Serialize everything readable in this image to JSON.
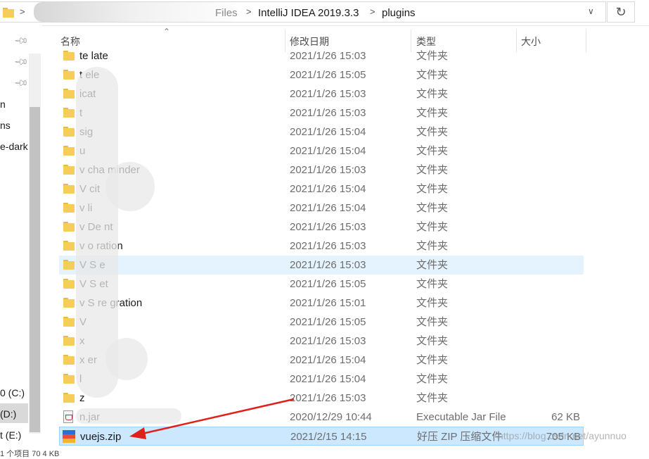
{
  "address_bar": {
    "segments": [
      "Files",
      "IntelliJ IDEA 2019.3.3",
      "plugins"
    ],
    "refresh_icon": "refresh-icon",
    "dropdown_icon": "chevron-down-icon"
  },
  "nav_pane": {
    "partial_labels": [
      "n",
      "ns",
      "e-dark"
    ],
    "drives": [
      "0 (C:)",
      "(D:)",
      "t (E:)"
    ],
    "status_fragment": "1 个项目 70 4 KB"
  },
  "columns": {
    "name": "名称",
    "date": "修改日期",
    "type": "类型",
    "size": "大小"
  },
  "rows": [
    {
      "name": "te    late",
      "date": "2021/1/26 15:03",
      "type": "文件夹",
      "size": "",
      "icon": "folder-icon"
    },
    {
      "name": "t    ele",
      "date": "2021/1/26 15:05",
      "type": "文件夹",
      "size": "",
      "icon": "folder-icon"
    },
    {
      "name": "    icat",
      "date": "2021/1/26 15:03",
      "type": "文件夹",
      "size": "",
      "icon": "folder-icon"
    },
    {
      "name": "     t",
      "date": "2021/1/26 15:03",
      "type": "文件夹",
      "size": "",
      "icon": "folder-icon"
    },
    {
      "name": "    sig",
      "date": "2021/1/26 15:04",
      "type": "文件夹",
      "size": "",
      "icon": "folder-icon"
    },
    {
      "name": "u",
      "date": "2021/1/26 15:04",
      "type": "文件夹",
      "size": "",
      "icon": "folder-icon"
    },
    {
      "name": "v    cha         minder",
      "date": "2021/1/26 15:03",
      "type": "文件夹",
      "size": "",
      "icon": "folder-icon"
    },
    {
      "name": "V    cit",
      "date": "2021/1/26 15:04",
      "type": "文件夹",
      "size": "",
      "icon": "folder-icon"
    },
    {
      "name": "v    li",
      "date": "2021/1/26 15:04",
      "type": "文件夹",
      "size": "",
      "icon": "folder-icon"
    },
    {
      "name": "v    De          nt",
      "date": "2021/1/26 15:03",
      "type": "文件夹",
      "size": "",
      "icon": "folder-icon"
    },
    {
      "name": "v    o             ration",
      "date": "2021/1/26 15:03",
      "type": "文件夹",
      "size": "",
      "icon": "folder-icon"
    },
    {
      "name": "V    S      e",
      "date": "2021/1/26 15:03",
      "type": "文件夹",
      "size": "",
      "icon": "folder-icon"
    },
    {
      "name": "V    S      et",
      "date": "2021/1/26 15:05",
      "type": "文件夹",
      "size": "",
      "icon": "folder-icon"
    },
    {
      "name": "v    S      re     gration",
      "date": "2021/1/26 15:01",
      "type": "文件夹",
      "size": "",
      "icon": "folder-icon"
    },
    {
      "name": "V",
      "date": "2021/1/26 15:05",
      "type": "文件夹",
      "size": "",
      "icon": "folder-icon"
    },
    {
      "name": "x",
      "date": "2021/1/26 15:03",
      "type": "文件夹",
      "size": "",
      "icon": "folder-icon"
    },
    {
      "name": "x              er",
      "date": "2021/1/26 15:04",
      "type": "文件夹",
      "size": "",
      "icon": "folder-icon"
    },
    {
      "name": "    l",
      "date": "2021/1/26 15:04",
      "type": "文件夹",
      "size": "",
      "icon": "folder-icon"
    },
    {
      "name": "z",
      "date": "2021/1/26 15:03",
      "type": "文件夹",
      "size": "",
      "icon": "folder-icon"
    },
    {
      "name": "                    n.jar",
      "date": "2020/12/29 10:44",
      "type": "Executable Jar File",
      "size": "62 KB",
      "icon": "jar-file-icon"
    },
    {
      "name": "vuejs.zip",
      "date": "2021/2/15 14:15",
      "type": "好压 ZIP 压缩文件",
      "size": "705 KB",
      "icon": "zip-archive-icon"
    }
  ],
  "watermark": "https://blog.csdn.net/ayunnuo",
  "colors": {
    "selection": "#cce8ff",
    "hover": "#e5f3ff",
    "folder": "#f6cd58",
    "annotation_arrow": "#e0201b"
  }
}
